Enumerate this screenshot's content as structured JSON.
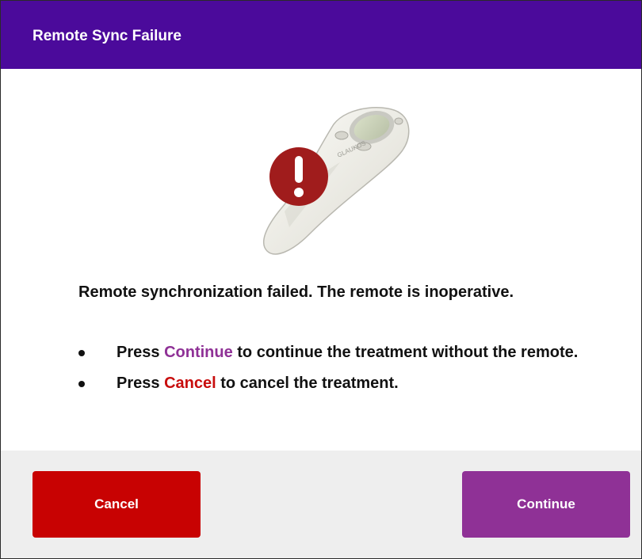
{
  "dialog": {
    "title": "Remote Sync Failure",
    "illustration": {
      "device_icon": "remote-control-icon",
      "alert_icon": "exclamation-circle-icon",
      "device_brand": "GLAUKOS",
      "alert_color": "#a01c1c"
    },
    "message": "Remote synchronization failed.  The remote is inoperative.",
    "bullets": [
      {
        "prefix": "Press ",
        "keyword": "Continue",
        "suffix": " to continue the treatment without the remote."
      },
      {
        "prefix": "Press ",
        "keyword": "Cancel",
        "suffix": " to cancel the treatment."
      }
    ]
  },
  "buttons": {
    "cancel_label": "Cancel",
    "continue_label": "Continue"
  },
  "colors": {
    "titlebar": "#4b0a9b",
    "cancel": "#c80202",
    "continue": "#8f3196",
    "footer": "#eeeeee"
  }
}
